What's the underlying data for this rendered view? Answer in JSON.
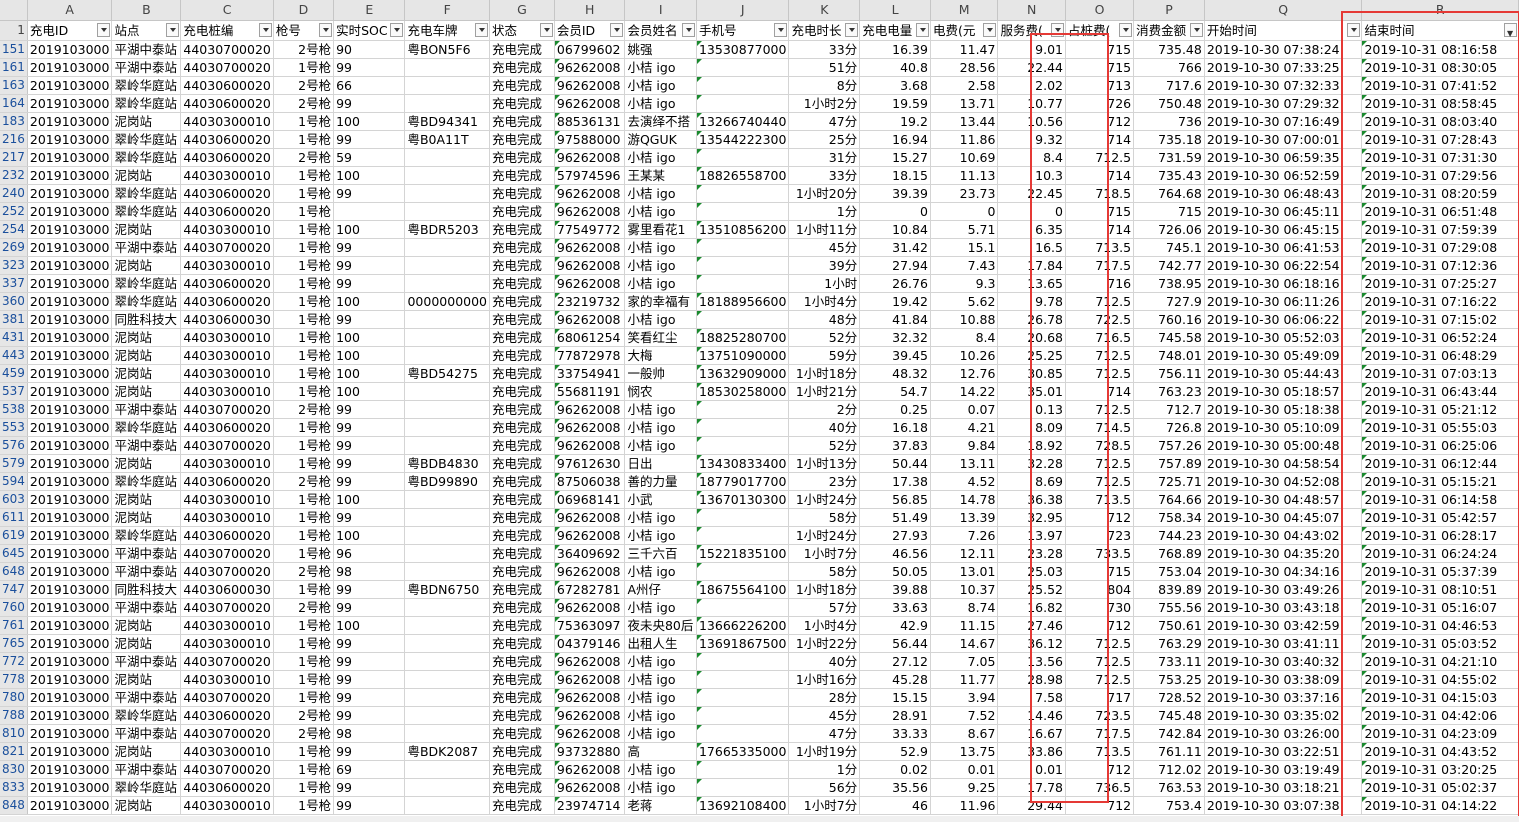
{
  "columns": [
    "",
    "A",
    "B",
    "C",
    "D",
    "E",
    "F",
    "G",
    "H",
    "I",
    "J",
    "K",
    "L",
    "M",
    "N",
    "O",
    "P",
    "Q",
    "R"
  ],
  "header_row_number": "1",
  "headers": [
    "充电ID",
    "站点",
    "充电桩编",
    "枪号",
    "实时SOC",
    "充电车牌",
    "状态",
    "会员ID",
    "会员姓名",
    "手机号",
    "充电时长",
    "充电电量",
    "电费(元",
    "服务费(",
    "占桩费(",
    "消费金额",
    "开始时间",
    "结束时间"
  ],
  "rows": [
    [
      "151",
      "2019103000",
      "平湖中泰站",
      "44030700020",
      "2号枪",
      "90",
      "粤BON5F6",
      "充电完成",
      "06799602",
      "姚强",
      "13530877000",
      "33分",
      "16.39",
      "11.47",
      "9.01",
      "715",
      "735.48",
      "2019-10-30  07:38:24",
      "2019-10-31  08:16:58"
    ],
    [
      "161",
      "2019103000",
      "平湖中泰站",
      "44030700020",
      "1号枪",
      "99",
      "",
      "充电完成",
      "96262008",
      "小桔 igo",
      "",
      "51分",
      "40.8",
      "28.56",
      "22.44",
      "715",
      "766",
      "2019-10-30  07:33:25",
      "2019-10-31  08:30:05"
    ],
    [
      "163",
      "2019103000",
      "翠岭华庭站",
      "44030600020",
      "2号枪",
      "66",
      "",
      "充电完成",
      "96262008",
      "小桔 igo",
      "",
      "8分",
      "3.68",
      "2.58",
      "2.02",
      "713",
      "717.6",
      "2019-10-30  07:32:33",
      "2019-10-31  07:41:52"
    ],
    [
      "164",
      "2019103000",
      "翠岭华庭站",
      "44030600020",
      "2号枪",
      "99",
      "",
      "充电完成",
      "96262008",
      "小桔 igo",
      "",
      "1小时2分",
      "19.59",
      "13.71",
      "10.77",
      "726",
      "750.48",
      "2019-10-30  07:29:32",
      "2019-10-31  08:58:45"
    ],
    [
      "183",
      "2019103000",
      "泥岗站",
      "44030300010",
      "1号枪",
      "100",
      "粤BD94341",
      "充电完成",
      "88536131",
      "去演绎不搭",
      "13266740440",
      "47分",
      "19.2",
      "13.44",
      "10.56",
      "712",
      "736",
      "2019-10-30  07:16:49",
      "2019-10-31  08:03:40"
    ],
    [
      "216",
      "2019103000",
      "翠岭华庭站",
      "44030600020",
      "1号枪",
      "99",
      "粤B0A11T",
      "充电完成",
      "97588000",
      "游QGUK",
      "13544222300",
      "25分",
      "16.94",
      "11.86",
      "9.32",
      "714",
      "735.18",
      "2019-10-30  07:00:01",
      "2019-10-31  07:28:43"
    ],
    [
      "217",
      "2019103000",
      "翠岭华庭站",
      "44030600020",
      "2号枪",
      "59",
      "",
      "充电完成",
      "96262008",
      "小桔 igo",
      "",
      "31分",
      "15.27",
      "10.69",
      "8.4",
      "712.5",
      "731.59",
      "2019-10-30  06:59:35",
      "2019-10-31  07:31:30"
    ],
    [
      "232",
      "2019103000",
      "泥岗站",
      "44030300010",
      "1号枪",
      "100",
      "",
      "充电完成",
      "57974596",
      "王某某",
      "18826558700",
      "33分",
      "18.15",
      "11.13",
      "10.3",
      "714",
      "735.43",
      "2019-10-30  06:52:59",
      "2019-10-31  07:29:56"
    ],
    [
      "240",
      "2019103000",
      "翠岭华庭站",
      "44030600020",
      "1号枪",
      "99",
      "",
      "充电完成",
      "96262008",
      "小桔 igo",
      "",
      "1小时20分",
      "39.39",
      "23.73",
      "22.45",
      "718.5",
      "764.68",
      "2019-10-30  06:48:43",
      "2019-10-31  08:20:59"
    ],
    [
      "252",
      "2019103000",
      "翠岭华庭站",
      "44030600020",
      "1号枪",
      "",
      "",
      "充电完成",
      "96262008",
      "小桔 igo",
      "",
      "1分",
      "0",
      "0",
      "0",
      "715",
      "715",
      "2019-10-30  06:45:11",
      "2019-10-31  06:51:48"
    ],
    [
      "254",
      "2019103000",
      "泥岗站",
      "44030300010",
      "1号枪",
      "100",
      "粤BDR5203",
      "充电完成",
      "77549772",
      "雾里看花1",
      "13510856200",
      "1小时11分",
      "10.84",
      "5.71",
      "6.35",
      "714",
      "726.06",
      "2019-10-30  06:45:15",
      "2019-10-31  07:59:39"
    ],
    [
      "269",
      "2019103000",
      "平湖中泰站",
      "44030700020",
      "1号枪",
      "99",
      "",
      "充电完成",
      "96262008",
      "小桔 igo",
      "",
      "45分",
      "31.42",
      "15.1",
      "16.5",
      "713.5",
      "745.1",
      "2019-10-30  06:41:53",
      "2019-10-31  07:29:08"
    ],
    [
      "323",
      "2019103000",
      "泥岗站",
      "44030300010",
      "1号枪",
      "99",
      "",
      "充电完成",
      "96262008",
      "小桔 igo",
      "",
      "39分",
      "27.94",
      "7.43",
      "17.84",
      "717.5",
      "742.77",
      "2019-10-30  06:22:54",
      "2019-10-31  07:12:36"
    ],
    [
      "337",
      "2019103000",
      "翠岭华庭站",
      "44030600020",
      "1号枪",
      "99",
      "",
      "充电完成",
      "96262008",
      "小桔 igo",
      "",
      "1小时",
      "26.76",
      "9.3",
      "13.65",
      "716",
      "738.95",
      "2019-10-30  06:18:16",
      "2019-10-31  07:25:27"
    ],
    [
      "360",
      "2019103000",
      "翠岭华庭站",
      "44030600020",
      "1号枪",
      "100",
      "0000000000",
      "充电完成",
      "23219732",
      "家的幸福有",
      "18188956600",
      "1小时4分",
      "19.42",
      "5.62",
      "9.78",
      "712.5",
      "727.9",
      "2019-10-30  06:11:26",
      "2019-10-31  07:16:22"
    ],
    [
      "381",
      "2019103000",
      "同胜科技大",
      "44030600030",
      "1号枪",
      "99",
      "",
      "充电完成",
      "96262008",
      "小桔 igo",
      "",
      "48分",
      "41.84",
      "10.88",
      "26.78",
      "722.5",
      "760.16",
      "2019-10-30  06:06:22",
      "2019-10-31  07:15:02"
    ],
    [
      "431",
      "2019103000",
      "泥岗站",
      "44030300010",
      "1号枪",
      "100",
      "",
      "充电完成",
      "68061254",
      "笑看红尘",
      "18825280700",
      "52分",
      "32.32",
      "8.4",
      "20.68",
      "716.5",
      "745.58",
      "2019-10-30  05:52:03",
      "2019-10-31  06:52:24"
    ],
    [
      "443",
      "2019103000",
      "泥岗站",
      "44030300010",
      "1号枪",
      "100",
      "",
      "充电完成",
      "77872978",
      "大梅",
      "13751090000",
      "59分",
      "39.45",
      "10.26",
      "25.25",
      "712.5",
      "748.01",
      "2019-10-30  05:49:09",
      "2019-10-31  06:48:29"
    ],
    [
      "459",
      "2019103000",
      "泥岗站",
      "44030300010",
      "1号枪",
      "100",
      "粤BD54275",
      "充电完成",
      "33754941",
      "一般帅",
      "13632909000",
      "1小时18分",
      "48.32",
      "12.76",
      "30.85",
      "712.5",
      "756.11",
      "2019-10-30  05:44:43",
      "2019-10-31  07:03:13"
    ],
    [
      "537",
      "2019103000",
      "泥岗站",
      "44030300010",
      "1号枪",
      "100",
      "",
      "充电完成",
      "55681191",
      "悯农",
      "18530258000",
      "1小时21分",
      "54.7",
      "14.22",
      "35.01",
      "714",
      "763.23",
      "2019-10-30  05:18:57",
      "2019-10-31  06:43:44"
    ],
    [
      "538",
      "2019103000",
      "平湖中泰站",
      "44030700020",
      "2号枪",
      "99",
      "",
      "充电完成",
      "96262008",
      "小桔 igo",
      "",
      "2分",
      "0.25",
      "0.07",
      "0.13",
      "712.5",
      "712.7",
      "2019-10-30  05:18:38",
      "2019-10-31  05:21:12"
    ],
    [
      "553",
      "2019103000",
      "翠岭华庭站",
      "44030600020",
      "1号枪",
      "99",
      "",
      "充电完成",
      "96262008",
      "小桔 igo",
      "",
      "40分",
      "16.18",
      "4.21",
      "8.09",
      "714.5",
      "726.8",
      "2019-10-30  05:10:09",
      "2019-10-31  05:55:03"
    ],
    [
      "576",
      "2019103000",
      "平湖中泰站",
      "44030700020",
      "1号枪",
      "99",
      "",
      "充电完成",
      "96262008",
      "小桔 igo",
      "",
      "52分",
      "37.83",
      "9.84",
      "18.92",
      "728.5",
      "757.26",
      "2019-10-30  05:00:48",
      "2019-10-31  06:25:06"
    ],
    [
      "579",
      "2019103000",
      "泥岗站",
      "44030300010",
      "1号枪",
      "99",
      "粤BDB4830",
      "充电完成",
      "97612630",
      "日出",
      "13430833400",
      "1小时13分",
      "50.44",
      "13.11",
      "32.28",
      "712.5",
      "757.89",
      "2019-10-30  04:58:54",
      "2019-10-31  06:12:44"
    ],
    [
      "594",
      "2019103000",
      "翠岭华庭站",
      "44030600020",
      "2号枪",
      "99",
      "粤BD99890",
      "充电完成",
      "87506038",
      "善的力量",
      "18779017700",
      "23分",
      "17.38",
      "4.52",
      "8.69",
      "712.5",
      "725.71",
      "2019-10-30  04:52:08",
      "2019-10-31  05:15:21"
    ],
    [
      "603",
      "2019103000",
      "泥岗站",
      "44030300010",
      "1号枪",
      "100",
      "",
      "充电完成",
      "06968141",
      "小武",
      "13670130300",
      "1小时24分",
      "56.85",
      "14.78",
      "36.38",
      "713.5",
      "764.66",
      "2019-10-30  04:48:57",
      "2019-10-31  06:14:58"
    ],
    [
      "611",
      "2019103000",
      "泥岗站",
      "44030300010",
      "1号枪",
      "99",
      "",
      "充电完成",
      "96262008",
      "小桔 igo",
      "",
      "58分",
      "51.49",
      "13.39",
      "32.95",
      "712",
      "758.34",
      "2019-10-30  04:45:07",
      "2019-10-31  05:42:57"
    ],
    [
      "619",
      "2019103000",
      "翠岭华庭站",
      "44030600020",
      "1号枪",
      "100",
      "",
      "充电完成",
      "96262008",
      "小桔 igo",
      "",
      "1小时24分",
      "27.93",
      "7.26",
      "13.97",
      "723",
      "744.23",
      "2019-10-30  04:43:02",
      "2019-10-31  06:28:17"
    ],
    [
      "645",
      "2019103000",
      "平湖中泰站",
      "44030700020",
      "1号枪",
      "96",
      "",
      "充电完成",
      "36409692",
      "三千六百",
      "15221835100",
      "1小时7分",
      "46.56",
      "12.11",
      "23.28",
      "733.5",
      "768.89",
      "2019-10-30  04:35:20",
      "2019-10-31  06:24:24"
    ],
    [
      "648",
      "2019103000",
      "平湖中泰站",
      "44030700020",
      "2号枪",
      "98",
      "",
      "充电完成",
      "96262008",
      "小桔 igo",
      "",
      "58分",
      "50.05",
      "13.01",
      "25.03",
      "715",
      "753.04",
      "2019-10-30  04:34:16",
      "2019-10-31  05:37:39"
    ],
    [
      "747",
      "2019103000",
      "同胜科技大",
      "44030600030",
      "1号枪",
      "99",
      "粤BDN6750",
      "充电完成",
      "67282781",
      "A州仔",
      "18675564100",
      "1小时18分",
      "39.88",
      "10.37",
      "25.52",
      "804",
      "839.89",
      "2019-10-30  03:49:26",
      "2019-10-31  08:10:51"
    ],
    [
      "760",
      "2019103000",
      "平湖中泰站",
      "44030700020",
      "2号枪",
      "99",
      "",
      "充电完成",
      "96262008",
      "小桔 igo",
      "",
      "57分",
      "33.63",
      "8.74",
      "16.82",
      "730",
      "755.56",
      "2019-10-30  03:43:18",
      "2019-10-31  05:16:07"
    ],
    [
      "761",
      "2019103000",
      "泥岗站",
      "44030300010",
      "1号枪",
      "100",
      "",
      "充电完成",
      "75363097",
      "夜未央80后",
      "13666226200",
      "1小时4分",
      "42.9",
      "11.15",
      "27.46",
      "712",
      "750.61",
      "2019-10-30  03:42:59",
      "2019-10-31  04:46:53"
    ],
    [
      "765",
      "2019103000",
      "泥岗站",
      "44030300010",
      "1号枪",
      "99",
      "",
      "充电完成",
      "04379146",
      "出租人生",
      "13691867500",
      "1小时22分",
      "56.44",
      "14.67",
      "36.12",
      "712.5",
      "763.29",
      "2019-10-30  03:41:11",
      "2019-10-31  05:03:52"
    ],
    [
      "772",
      "2019103000",
      "平湖中泰站",
      "44030700020",
      "1号枪",
      "99",
      "",
      "充电完成",
      "96262008",
      "小桔 igo",
      "",
      "40分",
      "27.12",
      "7.05",
      "13.56",
      "712.5",
      "733.11",
      "2019-10-30  03:40:32",
      "2019-10-31  04:21:10"
    ],
    [
      "778",
      "2019103000",
      "泥岗站",
      "44030300010",
      "1号枪",
      "99",
      "",
      "充电完成",
      "96262008",
      "小桔 igo",
      "",
      "1小时16分",
      "45.28",
      "11.77",
      "28.98",
      "712.5",
      "753.25",
      "2019-10-30  03:38:09",
      "2019-10-31  04:55:02"
    ],
    [
      "780",
      "2019103000",
      "平湖中泰站",
      "44030700020",
      "1号枪",
      "99",
      "",
      "充电完成",
      "96262008",
      "小桔 igo",
      "",
      "28分",
      "15.15",
      "3.94",
      "7.58",
      "717",
      "728.52",
      "2019-10-30  03:37:16",
      "2019-10-31  04:15:03"
    ],
    [
      "788",
      "2019103000",
      "翠岭华庭站",
      "44030600020",
      "2号枪",
      "99",
      "",
      "充电完成",
      "96262008",
      "小桔 igo",
      "",
      "45分",
      "28.91",
      "7.52",
      "14.46",
      "723.5",
      "745.48",
      "2019-10-30  03:35:02",
      "2019-10-31  04:42:06"
    ],
    [
      "810",
      "2019103000",
      "平湖中泰站",
      "44030700020",
      "2号枪",
      "98",
      "",
      "充电完成",
      "96262008",
      "小桔 igo",
      "",
      "47分",
      "33.33",
      "8.67",
      "16.67",
      "717.5",
      "742.84",
      "2019-10-30  03:26:00",
      "2019-10-31  04:23:09"
    ],
    [
      "821",
      "2019103000",
      "泥岗站",
      "44030300010",
      "1号枪",
      "99",
      "粤BDK2087",
      "充电完成",
      "93732880",
      "高",
      "17665335000",
      "1小时19分",
      "52.9",
      "13.75",
      "33.86",
      "713.5",
      "761.11",
      "2019-10-30  03:22:51",
      "2019-10-31  04:43:52"
    ],
    [
      "830",
      "2019103000",
      "平湖中泰站",
      "44030700020",
      "1号枪",
      "69",
      "",
      "充电完成",
      "96262008",
      "小桔 igo",
      "",
      "1分",
      "0.02",
      "0.01",
      "0.01",
      "712",
      "712.02",
      "2019-10-30  03:19:49",
      "2019-10-31  03:20:25"
    ],
    [
      "833",
      "2019103000",
      "翠岭华庭站",
      "44030600020",
      "1号枪",
      "99",
      "",
      "充电完成",
      "96262008",
      "小桔 igo",
      "",
      "56分",
      "35.56",
      "9.25",
      "17.78",
      "736.5",
      "763.53",
      "2019-10-30  03:18:21",
      "2019-10-31  05:02:37"
    ],
    [
      "848",
      "2019103000",
      "泥岗站",
      "44030300010",
      "1号枪",
      "99",
      "",
      "充电完成",
      "23974714",
      "老蒋",
      "13692108400",
      "1小时7分",
      "46",
      "11.96",
      "29.44",
      "712",
      "753.4",
      "2019-10-30  03:07:38",
      "2019-10-31  04:14:22"
    ]
  ],
  "colors": {
    "highlight": "#e53935",
    "grid": "#d4d4d4",
    "header_bg": "#e6e6e6",
    "row_number": "#1a4f9c",
    "marker": "#1a8a2e"
  }
}
